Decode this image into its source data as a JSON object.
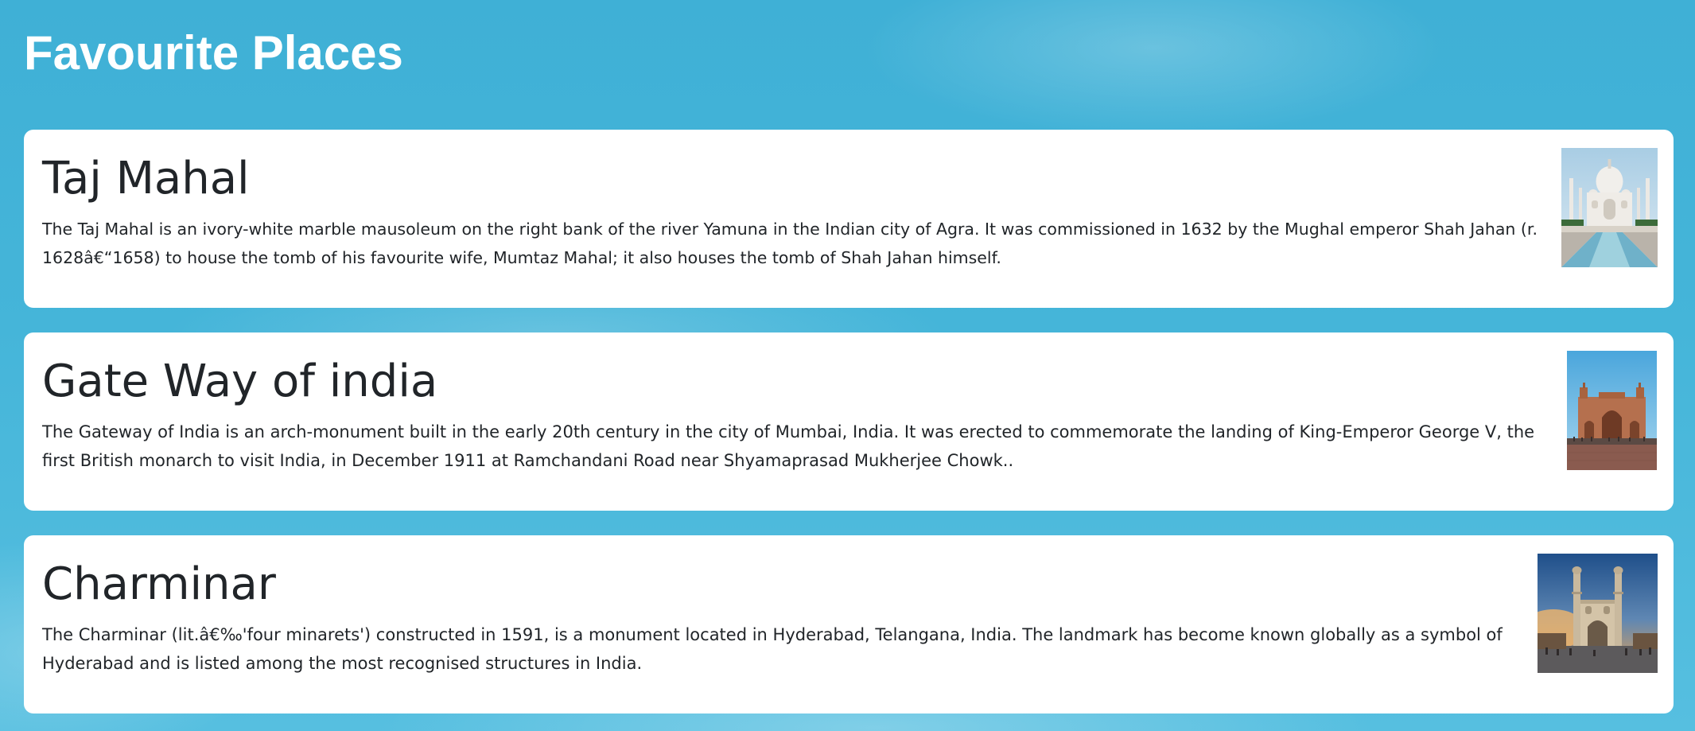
{
  "page": {
    "title": "Favourite Places"
  },
  "places": [
    {
      "name": "Taj Mahal",
      "description": "The Taj Mahal is an ivory-white marble mausoleum on the right bank of the river Yamuna in the Indian city of Agra. It was commissioned in 1632 by the Mughal emperor Shah Jahan (r. 1628â€“1658) to house the tomb of his favourite wife, Mumtaz Mahal; it also houses the tomb of Shah Jahan himself.",
      "image_icon": "taj-mahal-photo"
    },
    {
      "name": "Gate Way of india",
      "description": "The Gateway of India is an arch-monument built in the early 20th century in the city of Mumbai, India. It was erected to commemorate the landing of King-Emperor George V, the first British monarch to visit India, in December 1911 at Ramchandani Road near Shyamaprasad Mukherjee Chowk..",
      "image_icon": "gateway-of-india-photo"
    },
    {
      "name": "Charminar",
      "description": "The Charminar (lit.â€‰'four minarets') constructed in 1591, is a monument located in Hyderabad, Telangana, India. The landmark has become known globally as a symbol of Hyderabad and is listed among the most recognised structures in India.",
      "image_icon": "charminar-photo"
    }
  ],
  "colors": {
    "background": "#45b5d9",
    "card": "#ffffff",
    "text": "#212529",
    "title": "#ffffff"
  }
}
